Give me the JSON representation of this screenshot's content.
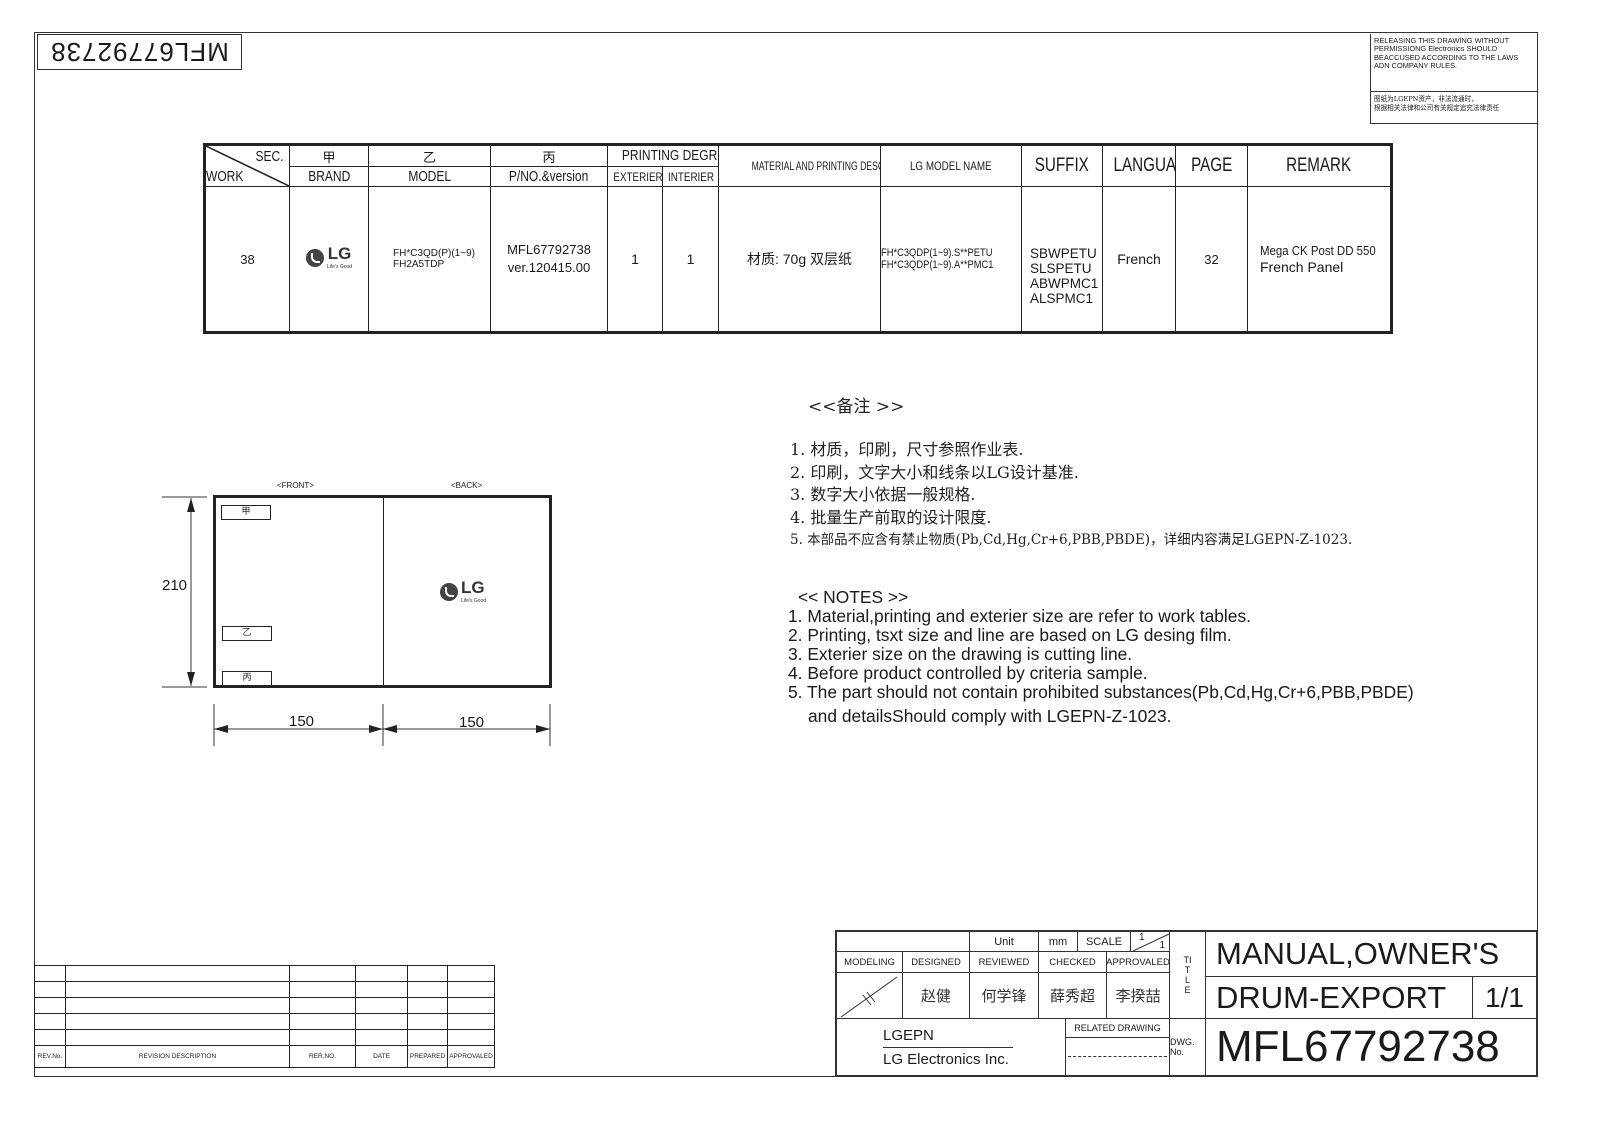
{
  "header": {
    "mirrored_part_number": "MFL67792738",
    "notice_en": "RELEASING THIS DRAWING WITHOUT PERMISSIONG Electronics SHOULD BEACCUSED ACCORDING TO THE LAWS ADN COMPANY RULES.",
    "notice_zh_line1": "图纸为LGEPN资产，非法流通时，",
    "notice_zh_line2": "根据相关法律和公司有关规定追究法律责任"
  },
  "work_table": {
    "corner_top": "SEC.",
    "corner_bottom": "WORK",
    "sec_labels": [
      "甲",
      "乙",
      "丙"
    ],
    "headers": {
      "brand": "BRAND",
      "model": "MODEL",
      "pno": "P/NO.&version",
      "printing_degree": "PRINTING DEGREE",
      "exterier": "EXTERIER",
      "interier": "INTERIER",
      "material": "MATERIAL AND PRINTING DESCRIPTION",
      "lg_model_name": "LG MODEL NAME",
      "suffix": "SUFFIX",
      "language": "LANGUAGE",
      "page": "PAGE",
      "remark": "REMARK"
    },
    "row": {
      "work": "38",
      "brand_logo": "LG",
      "brand_tagline": "Life's Good",
      "model_line1": "FH*C3QD(P)(1~9)",
      "model_line2": "FH2A5TDP",
      "pno_line1": "MFL67792738",
      "pno_line2": "ver.120415.00",
      "exterier": "1",
      "interier": "1",
      "material": "材质: 70g 双层纸",
      "lg_model_name_line1": "FH*C3QDP(1~9).S**PETU",
      "lg_model_name_line2": "FH*C3QDP(1~9).A**PMC1",
      "suffix": [
        "SBWPETU",
        "SLSPETU",
        "ABWPMC1",
        "ALSPMC1"
      ],
      "language": "French",
      "page": "32",
      "remark_line1": "Mega CK Post DD 550",
      "remark_line2": "French Panel"
    }
  },
  "drawing": {
    "front_label": "<FRONT>",
    "back_label": "<BACK>",
    "height_dim": "210",
    "width_dim_left": "150",
    "width_dim_right": "150",
    "box_labels": [
      "甲",
      "乙",
      "丙"
    ],
    "back_logo": "LG",
    "back_tagline": "Life's Good"
  },
  "notes_zh": {
    "title": "<<备注 >>",
    "lines": [
      "1.  材质，印刷，尺寸参照作业表.",
      "2.  印刷，文字大小和线条以LG设计基准.",
      "3.  数字大小依据一般规格.",
      "4.  批量生产前取的设计限度.",
      "5.  本部品不应含有禁止物质(Pb,Cd,Hg,Cr+6,PBB,PBDE)，详细内容满足LGEPN-Z-1023."
    ]
  },
  "notes_en": {
    "title": " << NOTES >>",
    "lines": [
      "1. Material,printing and exterier size are refer to work tables.",
      "2. Printing, tsxt  size and line are based on LG desing film.",
      "3. Exterier size on the drawing is cutting line.",
      "4. Before product controlled by criteria sample.",
      "5. The part should not contain prohibited substances(Pb,Cd,Hg,Cr+6,PBB,PBDE)",
      "   and detailsShould comply with LGEPN-Z-1023."
    ]
  },
  "revision_table": {
    "headers": [
      "REV.No.",
      "REVISION DESCRIPTION",
      "RER.NO.",
      "DATE",
      "PREPARED",
      "APPROVALED"
    ]
  },
  "title_block": {
    "unit_label": "Unit",
    "unit_value": "mm",
    "scale_label": "SCALE",
    "scale_num": "1",
    "scale_den": "1",
    "roles": [
      "MODELING",
      "DESIGNED",
      "REVIEWED",
      "CHECKED",
      "APPROVALED"
    ],
    "signatures": [
      "赵健",
      "何学锋",
      "薛秀超",
      "李揆喆"
    ],
    "title_vertical": "TITLE",
    "title_line1": "MANUAL,OWNER'S",
    "title_line2": "DRUM-EXPORT",
    "sheet": "1/1",
    "company_code": "LGEPN",
    "company_name": "LG Electronics Inc.",
    "related_drawing": "RELATED DRAWING",
    "dwg_no_label": "DWG. No.",
    "dwg_no": "MFL67792738"
  }
}
